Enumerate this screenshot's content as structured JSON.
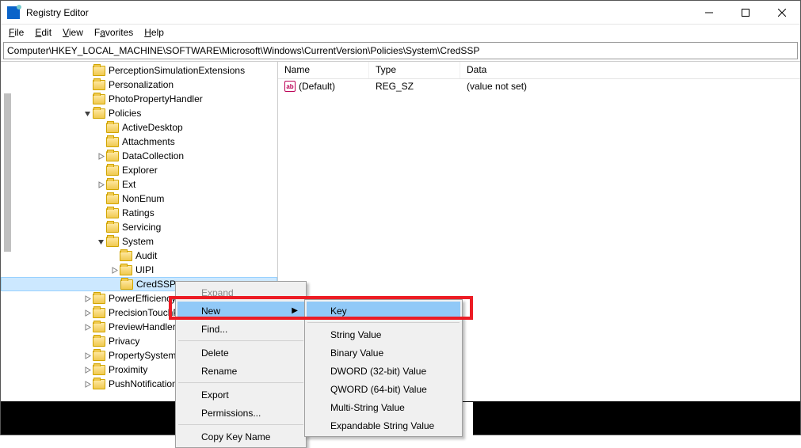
{
  "window": {
    "title": "Registry Editor"
  },
  "menubar": [
    {
      "u": "F",
      "rest": "ile"
    },
    {
      "u": "E",
      "rest": "dit"
    },
    {
      "u": "V",
      "rest": "iew"
    },
    {
      "u": "F",
      "rest": "avorites",
      "pre": ""
    },
    {
      "u": "H",
      "rest": "elp"
    }
  ],
  "address": "Computer\\HKEY_LOCAL_MACHINE\\SOFTWARE\\Microsoft\\Windows\\CurrentVersion\\Policies\\System\\CredSSP",
  "tree": [
    {
      "indent": 6,
      "exp": "",
      "label": "PerceptionSimulationExtensions"
    },
    {
      "indent": 6,
      "exp": "",
      "label": "Personalization"
    },
    {
      "indent": 6,
      "exp": "",
      "label": "PhotoPropertyHandler"
    },
    {
      "indent": 6,
      "exp": "v",
      "label": "Policies"
    },
    {
      "indent": 7,
      "exp": "",
      "label": "ActiveDesktop"
    },
    {
      "indent": 7,
      "exp": "",
      "label": "Attachments"
    },
    {
      "indent": 7,
      "exp": ">",
      "label": "DataCollection"
    },
    {
      "indent": 7,
      "exp": "",
      "label": "Explorer"
    },
    {
      "indent": 7,
      "exp": ">",
      "label": "Ext"
    },
    {
      "indent": 7,
      "exp": "",
      "label": "NonEnum"
    },
    {
      "indent": 7,
      "exp": "",
      "label": "Ratings"
    },
    {
      "indent": 7,
      "exp": "",
      "label": "Servicing"
    },
    {
      "indent": 7,
      "exp": "v",
      "label": "System"
    },
    {
      "indent": 8,
      "exp": "",
      "label": "Audit"
    },
    {
      "indent": 8,
      "exp": ">",
      "label": "UIPI"
    },
    {
      "indent": 8,
      "exp": "",
      "label": "CredSSP",
      "selected": true
    },
    {
      "indent": 6,
      "exp": ">",
      "label": "PowerEfficiencyDiagnostics"
    },
    {
      "indent": 6,
      "exp": ">",
      "label": "PrecisionTouchPad"
    },
    {
      "indent": 6,
      "exp": ">",
      "label": "PreviewHandlers"
    },
    {
      "indent": 6,
      "exp": "",
      "label": "Privacy"
    },
    {
      "indent": 6,
      "exp": ">",
      "label": "PropertySystem"
    },
    {
      "indent": 6,
      "exp": ">",
      "label": "Proximity"
    },
    {
      "indent": 6,
      "exp": ">",
      "label": "PushNotifications"
    }
  ],
  "list": {
    "headers": {
      "name": "Name",
      "type": "Type",
      "data": "Data"
    },
    "rows": [
      {
        "name": "(Default)",
        "type": "REG_SZ",
        "data": "(value not set)"
      }
    ]
  },
  "context_menu": {
    "items": [
      {
        "label": "Expand",
        "disabled": true
      },
      {
        "label": "New",
        "submenu": true,
        "highlight": true
      },
      {
        "label": "Find...",
        "pre_sep": false
      },
      {
        "sep": true
      },
      {
        "label": "Delete"
      },
      {
        "label": "Rename"
      },
      {
        "sep": true
      },
      {
        "label": "Export"
      },
      {
        "label": "Permissions..."
      },
      {
        "sep": true
      },
      {
        "label": "Copy Key Name"
      }
    ]
  },
  "submenu": {
    "items": [
      {
        "label": "Key",
        "highlight": true
      },
      {
        "sep": true
      },
      {
        "label": "String Value"
      },
      {
        "label": "Binary Value"
      },
      {
        "label": "DWORD (32-bit) Value"
      },
      {
        "label": "QWORD (64-bit) Value"
      },
      {
        "label": "Multi-String Value"
      },
      {
        "label": "Expandable String Value"
      }
    ]
  }
}
